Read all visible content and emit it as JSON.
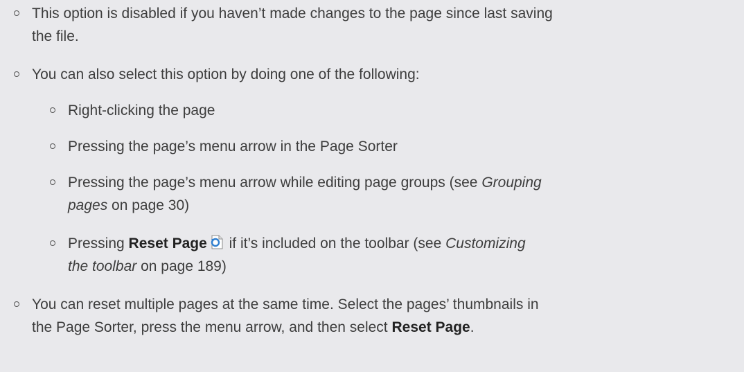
{
  "bullets": {
    "b1": {
      "text": "This option is disabled if you haven’t made changes to the page since last saving the file."
    },
    "b2": {
      "text": "You can also select this option by doing one of the following:",
      "sub": {
        "s1": {
          "text": "Right-clicking the page"
        },
        "s2": {
          "text": "Pressing the page’s menu arrow in the Page Sorter"
        },
        "s3": {
          "before": "Pressing the page’s menu arrow while editing page groups (see ",
          "link": "Grouping pages",
          "after": " on page 30)"
        },
        "s4": {
          "before": "Pressing ",
          "bold": "Reset Page",
          "icon": "reset-page-icon",
          "middle": " if it’s included on the toolbar (see ",
          "link": "Customizing the toolbar",
          "after": " on page 189)"
        }
      }
    },
    "b3": {
      "before": "You can reset multiple pages at the same time. Select the pages’ thumbnails in the Page Sorter, press the menu arrow, and then select ",
      "bold": "Reset Page",
      "after": "."
    }
  },
  "colors": {
    "background": "#e9e9ec",
    "text": "#3d3d3d",
    "icon_blue": "#2f7fd0"
  }
}
